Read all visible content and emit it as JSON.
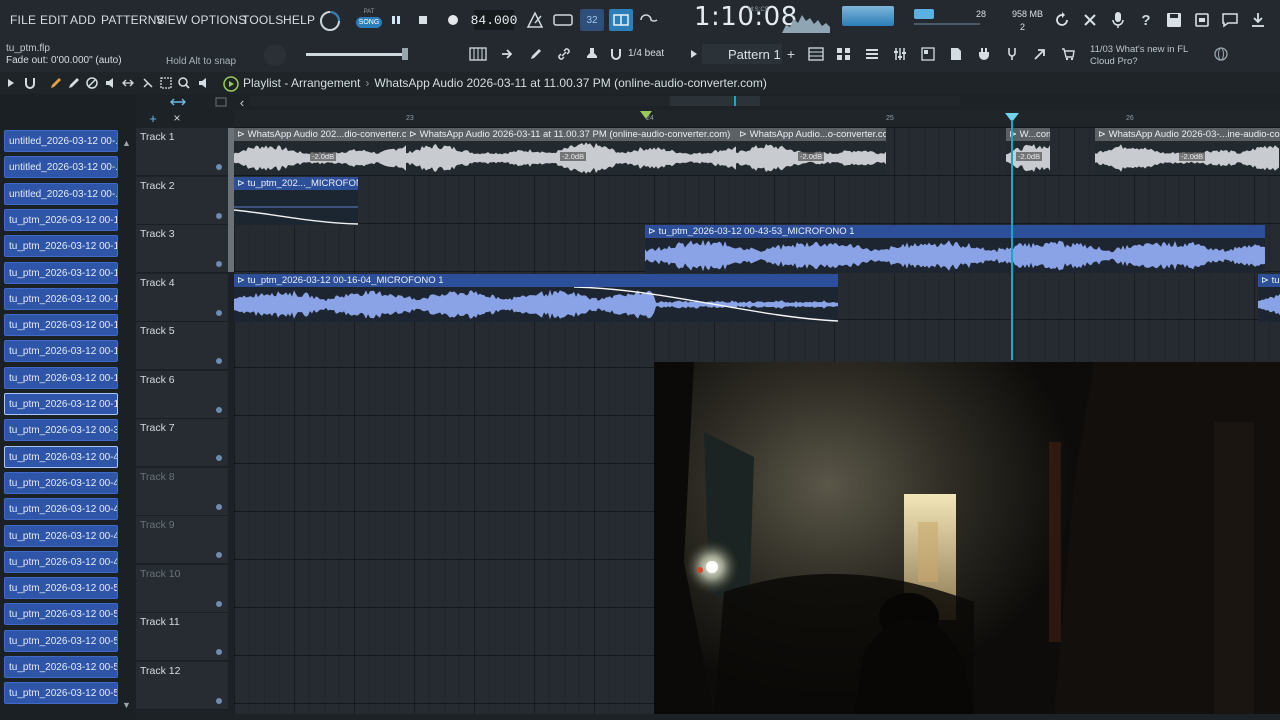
{
  "menu": [
    "FILE",
    "EDIT",
    "ADD",
    "PATTERNS",
    "VIEW",
    "OPTIONS",
    "TOOLS",
    "HELP"
  ],
  "transport": {
    "pat_song_top": "PAT",
    "pat_song_bottom": "SONG",
    "tempo": "84.000",
    "time": "1:10:08",
    "time_label": "M:S:CS",
    "step_display": "32",
    "cpu_value": "28",
    "memory": "958 MB",
    "voices": "2"
  },
  "hint": {
    "filename": "tu_ptm.flp",
    "fade_out": "Fade out:  0'00.000\" (auto)",
    "snap_hint": "Hold Alt to snap"
  },
  "toolbar2": {
    "snap_value": "1/4 beat",
    "pattern": "Pattern 1",
    "news_date": "11/03",
    "news_text": "What's new in FL",
    "news_text2": "Cloud Pro?"
  },
  "playlist": {
    "title": "Playlist - Arrangement",
    "subtitle": "WhatsApp Audio 2026-03-11 at 11.00.37 PM (online-audio-converter.com)"
  },
  "timeline": {
    "bars": [
      "23",
      "24",
      "25",
      "26"
    ]
  },
  "clip_list": [
    "untitled_2026-03-12 00-...",
    "untitled_2026-03-12 00-...",
    "untitled_2026-03-12 00-...",
    "tu_ptm_2026-03-12 00-1...",
    "tu_ptm_2026-03-12 00-1...",
    "tu_ptm_2026-03-12 00-1...",
    "tu_ptm_2026-03-12 00-1...",
    "tu_ptm_2026-03-12 00-1...",
    "tu_ptm_2026-03-12 00-1...",
    "tu_ptm_2026-03-12 00-1...",
    "tu_ptm_2026-03-12 00-1...",
    "tu_ptm_2026-03-12 00-3...",
    "tu_ptm_2026-03-12 00-4...",
    "tu_ptm_2026-03-12 00-4...",
    "tu_ptm_2026-03-12 00-4...",
    "tu_ptm_2026-03-12 00-4...",
    "tu_ptm_2026-03-12 00-4...",
    "tu_ptm_2026-03-12 00-5...",
    "tu_ptm_2026-03-12 00-5...",
    "tu_ptm_2026-03-12 00-5...",
    "tu_ptm_2026-03-12 00-5...",
    "tu_ptm_2026-03-12 00-5..."
  ],
  "tracks": [
    "Track 1",
    "Track 2",
    "Track 3",
    "Track 4",
    "Track 5",
    "Track 6",
    "Track 7",
    "Track 8",
    "Track 9",
    "Track 10",
    "Track 11",
    "Track 12"
  ],
  "clips": {
    "wa1": "WhatsApp Audio 202...dio-converter.com)",
    "wa2": "WhatsApp Audio 2026-03-11 at 11.00.37 PM (online-audio-converter.com)",
    "wa3": "WhatsApp Audio...o-converter.com)",
    "wa4": "W...com)",
    "wa5": "WhatsApp Audio 2026-03-...ine-audio-converter.com)",
    "mic2": "tu_ptm_202..._MICROFONO 1",
    "mic3": "tu_ptm_2026-03-12 00-43-53_MICROFONO 1",
    "mic4": "tu_ptm_2026-03-12 00-16-04_MICROFONO 1",
    "mic4b": "tu",
    "gain": "-2.0dB"
  },
  "colors": {
    "accent": "#2b7eb8",
    "clip_blue": "#2d4f9a",
    "wave_blue": "#8aa3e6",
    "playhead": "#19a6c8"
  }
}
